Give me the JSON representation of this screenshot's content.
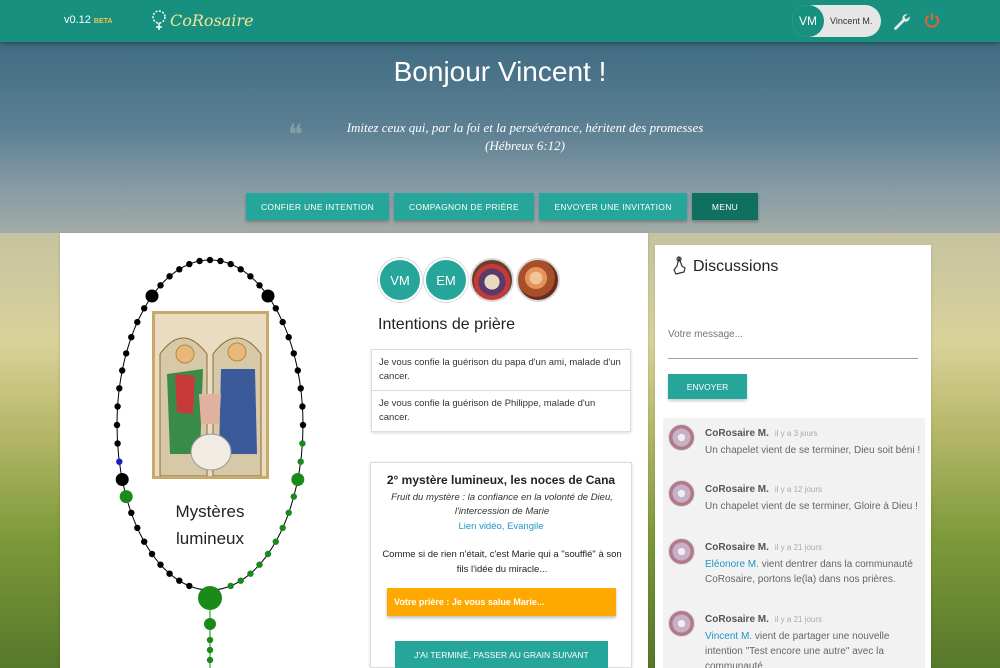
{
  "header": {
    "version": "v0.12",
    "beta_label": "BETA",
    "logo_text": "CoRosaire",
    "user_initials": "VM",
    "user_name": "Vincent M."
  },
  "hero": {
    "greeting": "Bonjour Vincent !",
    "quote_line1": "Imitez ceux qui, par la foi et la persévérance, héritent des promesses",
    "quote_line2": "(Hébreux 6:12)",
    "buttons": [
      "CONFIER UNE INTENTION",
      "COMPAGNON DE PRIÈRE",
      "ENVOYER UNE INVITATION",
      "MENU"
    ]
  },
  "rosary": {
    "mystery_label_line1": "Mystères",
    "mystery_label_line2": "lumineux",
    "colors": {
      "done": "#1a8a1a",
      "current": "#1a1acc",
      "pending": "#000000"
    }
  },
  "companions": [
    {
      "initials": "VM"
    },
    {
      "initials": "EM"
    },
    {
      "initials": ""
    },
    {
      "initials": ""
    }
  ],
  "intentions": {
    "title": "Intentions de prière",
    "items": [
      "Je vous confie la guérison du papa d'un ami, malade d'un cancer.",
      "Je vous confie la guérison de Philippe, malade d'un cancer."
    ]
  },
  "mystery": {
    "title": "2° mystère lumineux, les noces de Cana",
    "fruit_line1": "Fruit du mystère : la confiance en la volonté de Dieu,",
    "fruit_line2": "l'intercession de Marie",
    "link_video": "Lien vidéo",
    "link_sep": ", ",
    "link_gospel": "Evangile",
    "text": "Comme si de rien n'était, c'est Marie qui a \"soufflé\" à son fils l'idée du miracle...",
    "prayer": "Votre prière : Je vous salue Marie...",
    "next_button": "J'AI TERMINÉ, PASSER AU GRAIN SUIVANT"
  },
  "discussions": {
    "title": "Discussions",
    "input_placeholder": "Votre message...",
    "send_button": "ENVOYER",
    "messages": [
      {
        "author": "CoRosaire M.",
        "time": "il y a 3 jours",
        "link": "",
        "text": "Un chapelet vient de se terminer, Dieu soit béni !"
      },
      {
        "author": "CoRosaire M.",
        "time": "il y a 12 jours",
        "link": "",
        "text": "Un chapelet vient de se terminer, Gloire à Dieu !"
      },
      {
        "author": "CoRosaire M.",
        "time": "il y a 21 jours",
        "link": "Eléonore M.",
        "text": " vient dentrer dans la communauté CoRosaire, portons le(la) dans nos prières."
      },
      {
        "author": "CoRosaire M.",
        "time": "il y a 21 jours",
        "link": "Vincent M.",
        "text": " vient de partager une nouvelle intention \"Test encore une autre\" avec la communauté."
      }
    ]
  }
}
